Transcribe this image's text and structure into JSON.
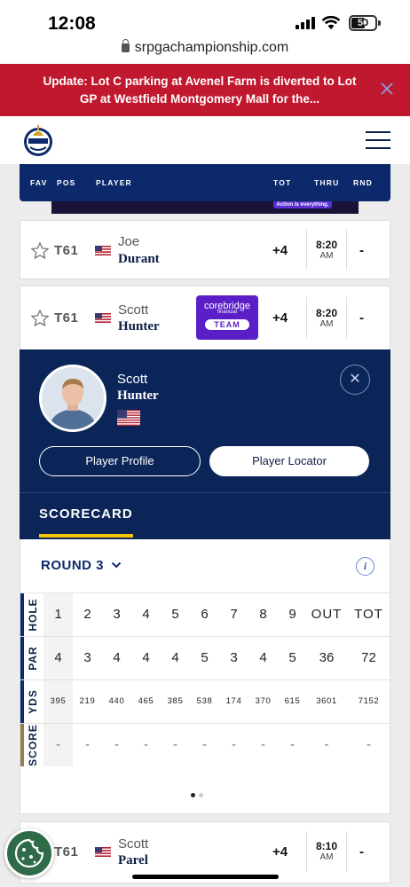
{
  "status_bar": {
    "time": "12:08",
    "battery": "50"
  },
  "browser": {
    "url": "srpgachampionship.com"
  },
  "alert": {
    "text": "Update: Lot C parking at Avenel Farm is diverted to Lot GP at Westfield Montgomery Mall for the..."
  },
  "leaderboard": {
    "headers": {
      "fav": "FAV",
      "pos": "POS",
      "player": "PLAYER",
      "tot": "TOT",
      "thru": "THRU",
      "rnd": "RND"
    },
    "ad_badge": "Action is everything.",
    "rows": [
      {
        "pos": "T61",
        "first": "Joe",
        "last": "Durant",
        "tot": "+4",
        "thru_time": "8:20",
        "thru_ampm": "AM",
        "rnd": "-"
      },
      {
        "pos": "T61",
        "first": "Scott",
        "last": "Hunter",
        "tot": "+4",
        "thru_time": "8:20",
        "thru_ampm": "AM",
        "rnd": "-",
        "badge_brand": "corebridge",
        "badge_sub": "financial",
        "badge_team": "TEAM"
      },
      {
        "pos": "T61",
        "first": "Scott",
        "last": "Parel",
        "tot": "+4",
        "thru_time": "8:10",
        "thru_ampm": "AM",
        "rnd": "-"
      }
    ]
  },
  "player_detail": {
    "first": "Scott",
    "last": "Hunter",
    "profile_button": "Player Profile",
    "locator_button": "Player Locator",
    "scorecard_tab": "SCORECARD"
  },
  "scorecard": {
    "round_label": "ROUND 3",
    "info_glyph": "i",
    "rows": [
      {
        "label": "HOLE",
        "cells": [
          "1",
          "2",
          "3",
          "4",
          "5",
          "6",
          "7",
          "8",
          "9",
          "OUT",
          "TOT"
        ]
      },
      {
        "label": "PAR",
        "cells": [
          "4",
          "3",
          "4",
          "4",
          "4",
          "5",
          "3",
          "4",
          "5",
          "36",
          "72"
        ]
      },
      {
        "label": "YDS",
        "cells": [
          "395",
          "219",
          "440",
          "465",
          "385",
          "538",
          "174",
          "370",
          "615",
          "3601",
          "7152"
        ]
      },
      {
        "label": "SCORE",
        "cells": [
          "-",
          "-",
          "-",
          "-",
          "-",
          "-",
          "-",
          "-",
          "-",
          "-",
          "-"
        ]
      }
    ],
    "row_colors": [
      "#0c2a6b",
      "#0c2a6b",
      "#0c2a6b",
      "#9a7b4f"
    ]
  },
  "colors": {
    "alert": "#c0182e",
    "navy": "#0c2a6b",
    "gold": "#f3c500",
    "team_purple": "#5a1fc6"
  },
  "icons": [
    "signal-icon",
    "wifi-icon",
    "lock-icon",
    "close-icon",
    "hamburger-icon",
    "star-icon",
    "us-flag-icon",
    "chevron-down-icon",
    "info-icon",
    "cookie-icon"
  ]
}
